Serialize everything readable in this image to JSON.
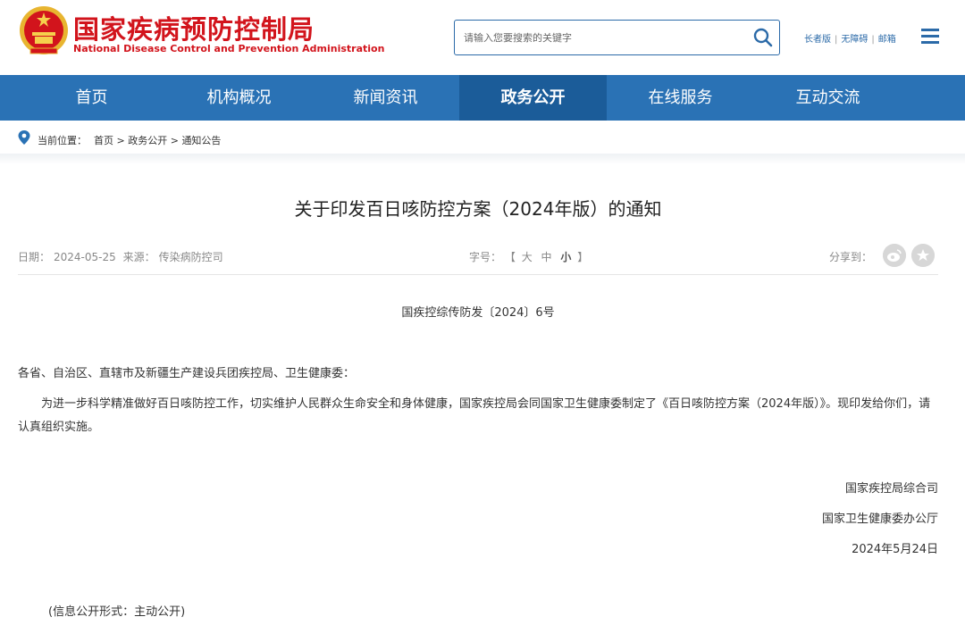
{
  "header": {
    "title_cn": "国家疾病预防控制局",
    "title_en": "National Disease Control and Prevention Administration",
    "brand_color": "#d2141c",
    "search_placeholder": "请输入您要搜索的关键字",
    "links": [
      "长者版",
      "无障碍",
      "邮箱"
    ]
  },
  "nav": {
    "color": "#2a72b5",
    "active_color": "#1b5c99",
    "items": [
      "首页",
      "机构概况",
      "新闻资讯",
      "政务公开",
      "在线服务",
      "互动交流"
    ],
    "active": "政务公开"
  },
  "breadcrumb": {
    "label": "当前位置：",
    "items": [
      "首页",
      "政务公开",
      "通知公告"
    ],
    "separator": " > "
  },
  "article": {
    "title": "关于印发百日咳防控方案（2024年版）的通知",
    "date_label": "日期：",
    "date": "2024-05-25",
    "source_label": "来源：",
    "source": "传染病防控司",
    "fontsize_label": "字号：",
    "fontsize_open": "【",
    "fontsize_options": [
      "大",
      "中",
      "小"
    ],
    "fontsize_close": "】",
    "share_label": "分享到：",
    "doc_number": "国疾控综传防发〔2024〕6号",
    "addressee": "各省、自治区、直辖市及新疆生产建设兵团疾控局、卫生健康委：",
    "body": "为进一步科学精准做好百日咳防控工作，切实维护人民群众生命安全和身体健康，国家疾控局会同国家卫生健康委制定了《百日咳防控方案（2024年版）》。现印发给你们，请认真组织实施。",
    "signatures": [
      "国家疾控局综合司",
      "国家卫生健康委办公厅"
    ],
    "sign_date": "2024年5月24日",
    "disclosure": "(信息公开形式：主动公开)"
  },
  "icons": [
    "national-emblem-icon",
    "search-icon",
    "menu-icon",
    "location-pin-icon",
    "weibo-share-icon",
    "favorite-star-icon"
  ]
}
